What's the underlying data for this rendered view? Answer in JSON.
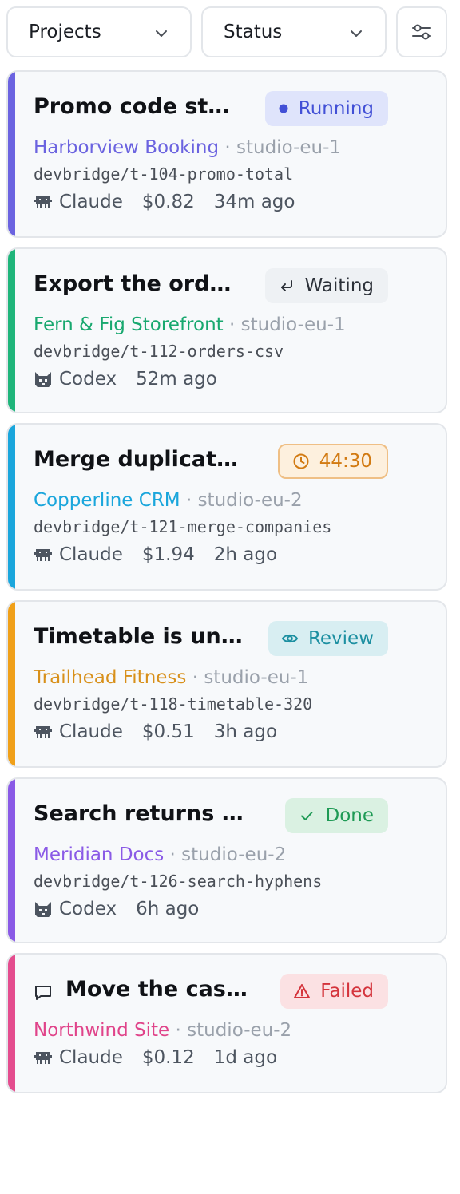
{
  "filters": {
    "projects_label": "Projects",
    "status_label": "Status",
    "icons": {
      "chevron": "chevron-down-icon",
      "filter": "sliders-icon"
    }
  },
  "tasks": [
    {
      "title": "Promo code st…",
      "status": "Running",
      "status_icon": "dot-icon",
      "project": "Harborview Booking",
      "host": "studio-eu-1",
      "branch": "devbridge/t-104-promo-total",
      "agent": "Claude",
      "agent_icon": "claude-icon",
      "cost": "$0.82",
      "age": "34m ago",
      "accent_color": "#6b63e0",
      "project_color": "#6b63e0",
      "badge_bg": "#dfe4fb",
      "badge_fg": "#4250d6"
    },
    {
      "title": "Export the ord…",
      "status": "Waiting",
      "status_icon": "return-arrow-icon",
      "project": "Fern & Fig Storefront",
      "host": "studio-eu-1",
      "branch": "devbridge/t-112-orders-csv",
      "agent": "Codex",
      "agent_icon": "codex-icon",
      "age": "52m ago",
      "accent_color": "#1fb57a",
      "project_color": "#18a86f",
      "badge_bg": "#eef1f4",
      "badge_fg": "#2b3038"
    },
    {
      "title": "Merge duplicate…",
      "status": "44:30",
      "status_icon": "clock-icon",
      "project": "Copperline CRM",
      "host": "studio-eu-2",
      "branch": "devbridge/t-121-merge-companies",
      "agent": "Claude",
      "agent_icon": "claude-icon",
      "cost": "$1.94",
      "age": "2h ago",
      "accent_color": "#1aa6dc",
      "project_color": "#1aa6dc",
      "badge_bg": "#fdf0de",
      "badge_fg": "#d27a12",
      "badge_border": "#efbf85"
    },
    {
      "title": "Timetable is un…",
      "status": "Review",
      "status_icon": "eye-icon",
      "project": "Trailhead Fitness",
      "host": "studio-eu-1",
      "branch": "devbridge/t-118-timetable-320",
      "agent": "Claude",
      "agent_icon": "claude-icon",
      "cost": "$0.51",
      "age": "3h ago",
      "accent_color": "#f0a019",
      "project_color": "#d8901a",
      "badge_bg": "#d8eef2",
      "badge_fg": "#1c8fa1"
    },
    {
      "title": "Search returns n…",
      "status": "Done",
      "status_icon": "check-icon",
      "project": "Meridian Docs",
      "host": "studio-eu-2",
      "branch": "devbridge/t-126-search-hyphens",
      "agent": "Codex",
      "agent_icon": "codex-icon",
      "age": "6h ago",
      "accent_color": "#8a5ae6",
      "project_color": "#8a5ae6",
      "badge_bg": "#daf1e2",
      "badge_fg": "#1e9a55"
    },
    {
      "title": "Move the cas…",
      "status": "Failed",
      "status_icon": "warning-icon",
      "project": "Northwind Site",
      "host": "studio-eu-2",
      "agent": "Claude",
      "agent_icon": "claude-icon",
      "cost": "$0.12",
      "age": "1d ago",
      "accent_color": "#e44d8e",
      "project_color": "#e0448a",
      "badge_bg": "#fbe1e3",
      "badge_fg": "#d4343c",
      "leading_icon": "comment-icon"
    }
  ]
}
